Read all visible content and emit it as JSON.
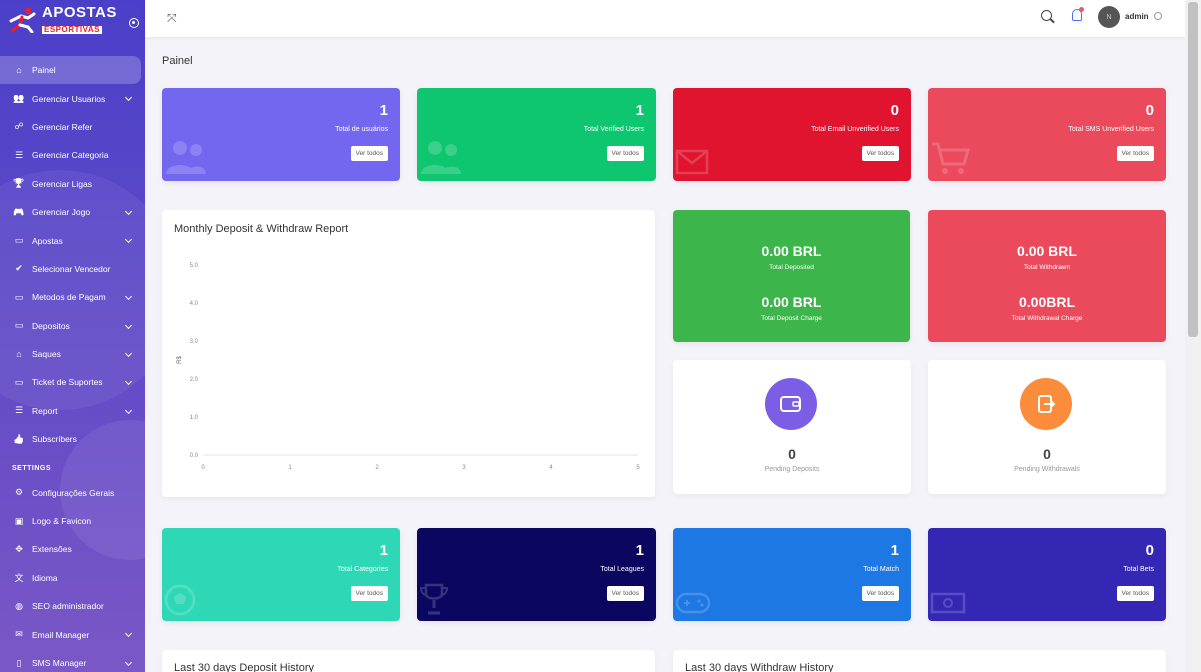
{
  "brand": {
    "name": "APOSTAS",
    "sub": "ESPORTIVAS"
  },
  "sidebar": {
    "items": [
      {
        "label": "Painel",
        "icon": "home-icon",
        "active": true,
        "chevron": false
      },
      {
        "label": "Gerenciar Usuarios",
        "icon": "users-icon",
        "chevron": true
      },
      {
        "label": "Gerenciar Refer",
        "icon": "network-icon",
        "chevron": false
      },
      {
        "label": "Gerenciar Categoria",
        "icon": "list-icon",
        "chevron": false
      },
      {
        "label": "Gerenciar Ligas",
        "icon": "trophy-icon",
        "chevron": false
      },
      {
        "label": "Gerenciar Jogo",
        "icon": "gamepad-icon",
        "chevron": true
      },
      {
        "label": "Apostas",
        "icon": "ticket-icon",
        "chevron": true
      },
      {
        "label": "Selecionar Vencedor",
        "icon": "user-check-icon",
        "chevron": false
      },
      {
        "label": "Metodos de Pagam",
        "icon": "card-icon",
        "chevron": true
      },
      {
        "label": "Depositos",
        "icon": "deposit-icon",
        "chevron": true
      },
      {
        "label": "Saques",
        "icon": "bank-icon",
        "chevron": true
      },
      {
        "label": "Ticket de Suportes",
        "icon": "support-icon",
        "chevron": true
      },
      {
        "label": "Report",
        "icon": "report-icon",
        "chevron": true
      },
      {
        "label": "Subscribers",
        "icon": "thumbs-up-icon",
        "chevron": false
      }
    ],
    "settings_title": "SETTINGS",
    "settings_items": [
      {
        "label": "Configurações Gerais",
        "icon": "gear-icon",
        "chevron": false
      },
      {
        "label": "Logo & Favicon",
        "icon": "image-icon",
        "chevron": false
      },
      {
        "label": "Extensões",
        "icon": "puzzle-icon",
        "chevron": false
      },
      {
        "label": "Idioma",
        "icon": "language-icon",
        "chevron": false
      },
      {
        "label": "SEO administrador",
        "icon": "globe-icon",
        "chevron": false
      },
      {
        "label": "Email Manager",
        "icon": "envelope-icon",
        "chevron": true
      },
      {
        "label": "SMS Manager",
        "icon": "mobile-icon",
        "chevron": true
      }
    ]
  },
  "topbar": {
    "user_name": "admin",
    "avatar_initial": "N"
  },
  "page": {
    "title": "Painel"
  },
  "widgets_top": [
    {
      "value": "1",
      "label": "Total de usuários",
      "button": "Ver todos",
      "color": "#7367f0",
      "icon": "users-icon"
    },
    {
      "value": "1",
      "label": "Total Verified Users",
      "button": "Ver todos",
      "color": "#0ec66f",
      "icon": "users-check-icon"
    },
    {
      "value": "0",
      "label": "Total Email Unverified Users",
      "button": "Ver todos",
      "color": "#e0142f",
      "icon": "envelope-icon"
    },
    {
      "value": "0",
      "label": "Total SMS Unverified Users",
      "button": "Ver todos",
      "color": "#ea4a5b",
      "icon": "cart-icon"
    }
  ],
  "chart_data": {
    "type": "line",
    "title": "Monthly Deposit & Withdraw Report",
    "xlabel": "",
    "ylabel": "R$",
    "x_ticks": [
      "0",
      "1",
      "2",
      "3",
      "4",
      "5"
    ],
    "y_ticks": [
      "0.0",
      "1.0",
      "2.0",
      "3.0",
      "4.0",
      "5.0"
    ],
    "xlim": [
      0,
      5
    ],
    "ylim": [
      0,
      5
    ],
    "series": [],
    "grid": false
  },
  "summary": {
    "deposit": {
      "total": "0.00 BRL",
      "total_label": "Total Deposited",
      "charge": "0.00 BRL",
      "charge_label": "Total Deposit Charge",
      "color": "#3cb54a"
    },
    "withdraw": {
      "total": "0.00 BRL",
      "total_label": "Total Withdrawn",
      "charge": "0.00BRL",
      "charge_label": "Total Withdrawal Charge",
      "color": "#ea4a5b"
    }
  },
  "pending": {
    "deposits": {
      "value": "0",
      "label": "Pending Deposits",
      "color": "#7c5de6",
      "icon": "wallet-icon"
    },
    "withdrawals": {
      "value": "0",
      "label": "Pending Withdrawals",
      "color": "#fb8c3c",
      "icon": "exit-icon"
    }
  },
  "widgets_bottom": [
    {
      "value": "1",
      "label": "Total Categories",
      "button": "Ver todos",
      "color": "#2ed8b6",
      "icon": "football-icon"
    },
    {
      "value": "1",
      "label": "Total Leagues",
      "button": "Ver todos",
      "color": "#0b0761",
      "icon": "trophy-icon"
    },
    {
      "value": "1",
      "label": "Total Match",
      "button": "Ver todos",
      "color": "#1e78e4",
      "icon": "gamepad-icon"
    },
    {
      "value": "0",
      "label": "Total Bets",
      "button": "Ver todos",
      "color": "#3327b4",
      "icon": "money-icon"
    }
  ],
  "history": {
    "deposit_title": "Last 30 days Deposit History",
    "withdraw_title": "Last 30 days Withdraw History"
  }
}
